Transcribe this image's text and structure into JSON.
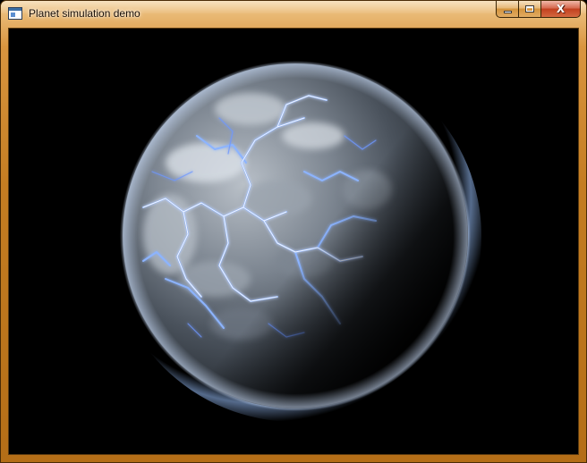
{
  "window": {
    "title": "Planet simulation demo"
  },
  "caption_buttons": {
    "minimize_icon": "minimize-icon",
    "maximize_icon": "maximize-icon",
    "close_icon": "close-icon",
    "close_glyph": "X"
  },
  "viewport": {
    "background_color": "#000000",
    "planet_colors": {
      "ocean": "#5f6b78",
      "ice": "#e6ecf4",
      "glow": "#8cb4ff",
      "atmosphere": "#9cc3ff"
    }
  },
  "theme": {
    "frame_color": "#c47d22",
    "frame_highlight": "#f0c98c",
    "close_button_color": "#c2401f"
  }
}
